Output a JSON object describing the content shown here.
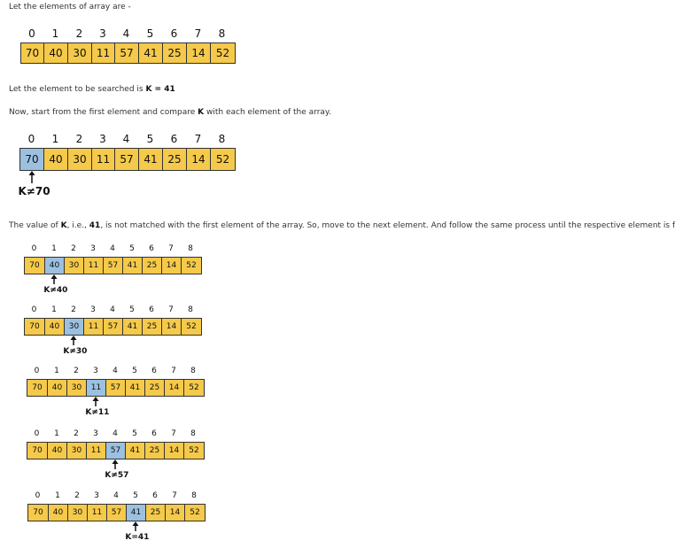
{
  "texts": {
    "intro": "Let the elements of array are -",
    "search_prefix": "Let the element to be searched is ",
    "search_key": "K = 41",
    "compare_prefix": "Now, start from the first element and compare ",
    "compare_key": "K",
    "compare_suffix": " with each element of the array.",
    "value_prefix": "The value of ",
    "value_k": "K",
    "value_mid": ", i.e., ",
    "value_num": "41",
    "value_suffix": ", is not matched with the first element of the array. So, move to the next element. And follow the same process until the respective element is found."
  },
  "indices": [
    "0",
    "1",
    "2",
    "3",
    "4",
    "5",
    "6",
    "7",
    "8"
  ],
  "values": [
    "70",
    "40",
    "30",
    "11",
    "57",
    "41",
    "25",
    "14",
    "52"
  ],
  "colors": {
    "cell": "#f5c949",
    "highlight": "#9cc0e0",
    "border": "#333333"
  },
  "arrays": [
    {
      "highlight": -1,
      "label": ""
    },
    {
      "highlight": 0,
      "label": "K≠70"
    },
    {
      "highlight": 1,
      "label": "K≠40"
    },
    {
      "highlight": 2,
      "label": "K≠30"
    },
    {
      "highlight": 3,
      "label": "K≠11"
    },
    {
      "highlight": 4,
      "label": "K≠57"
    },
    {
      "highlight": 5,
      "label": "K=41"
    }
  ]
}
